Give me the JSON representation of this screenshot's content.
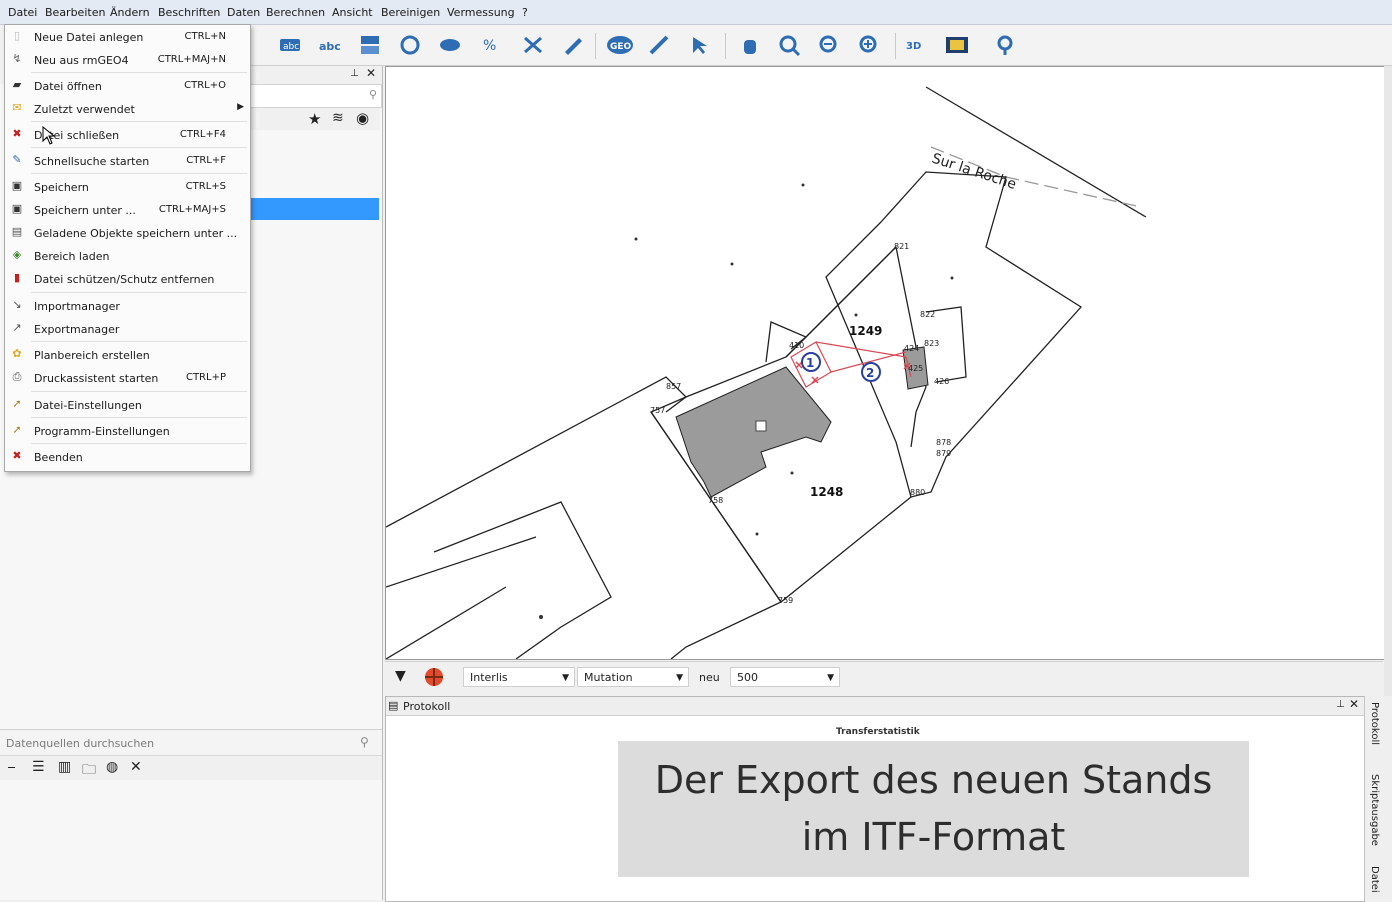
{
  "menubar": [
    "Datei",
    "Bearbeiten",
    "Ändern",
    "Beschriften",
    "Daten",
    "Berechnen",
    "Ansicht",
    "Bereinigen",
    "Vermessung",
    "?"
  ],
  "file_menu": {
    "items": [
      {
        "label": "Neue Datei anlegen",
        "shortcut": "CTRL+N",
        "icon": "new-file-icon"
      },
      {
        "label": "Neu aus rmGEO4",
        "shortcut": "CTRL+MAJ+N",
        "icon": "import-rmgeo-icon"
      },
      {
        "label": "Datei öffnen",
        "shortcut": "CTRL+O",
        "icon": "open-folder-icon"
      },
      {
        "label": "Zuletzt verwendet",
        "shortcut": "",
        "icon": "recent-icon",
        "submenu": true
      },
      {
        "label": "Datei schließen",
        "shortcut": "CTRL+F4",
        "icon": "close-file-icon"
      },
      {
        "label": "Schnellsuche starten",
        "shortcut": "CTRL+F",
        "icon": "quick-search-icon"
      },
      {
        "label": "Speichern",
        "shortcut": "CTRL+S",
        "icon": "save-icon"
      },
      {
        "label": "Speichern unter ...",
        "shortcut": "CTRL+MAJ+S",
        "icon": "save-as-icon"
      },
      {
        "label": "Geladene Objekte speichern unter ...",
        "shortcut": "",
        "icon": "save-objects-icon"
      },
      {
        "label": "Bereich laden",
        "shortcut": "",
        "icon": "load-area-icon"
      },
      {
        "label": "Datei schützen/Schutz entfernen",
        "shortcut": "",
        "icon": "protect-file-icon"
      },
      {
        "label": "Importmanager",
        "shortcut": "",
        "icon": "import-icon"
      },
      {
        "label": "Exportmanager",
        "shortcut": "",
        "icon": "export-icon"
      },
      {
        "label": "Planbereich erstellen",
        "shortcut": "",
        "icon": "plan-area-icon"
      },
      {
        "label": "Druckassistent starten",
        "shortcut": "CTRL+P",
        "icon": "print-icon"
      },
      {
        "label": "Datei-Einstellungen",
        "shortcut": "",
        "icon": "file-settings-icon"
      },
      {
        "label": "Programm-Einstellungen",
        "shortcut": "",
        "icon": "program-settings-icon"
      },
      {
        "label": "Beenden",
        "shortcut": "",
        "icon": "exit-icon"
      }
    ]
  },
  "datasource": {
    "placeholder": "Datenquellen durchsuchen"
  },
  "filterbar": {
    "format": "Interlis",
    "mode": "Mutation",
    "neu_label": "neu",
    "scale": "500"
  },
  "protokoll": {
    "title": "Protokoll",
    "section": "Transferstatistik"
  },
  "right_tabs": [
    "Protokoll",
    "Skriptausgabe",
    "Datei"
  ],
  "caption": {
    "line1": "Der Export des neuen Stands",
    "line2": "im ITF-Format"
  },
  "map": {
    "street": "Sur la Roche",
    "parcels": [
      "1249",
      "1248"
    ],
    "markers": [
      "1",
      "2"
    ],
    "point_labels": [
      "821",
      "822",
      "823",
      "857",
      "757",
      "758",
      "878",
      "879",
      "880",
      "759",
      "410",
      "424",
      "425",
      "426"
    ]
  }
}
